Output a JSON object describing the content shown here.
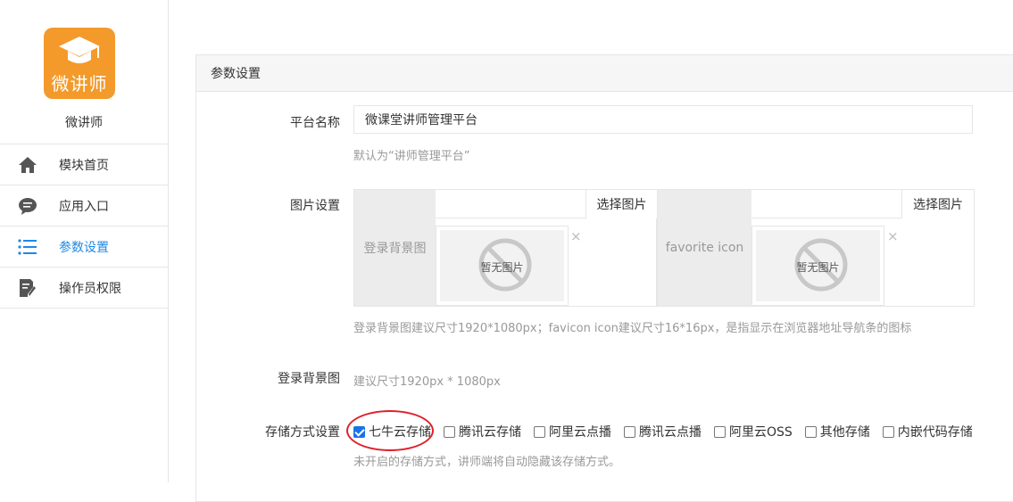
{
  "app": {
    "logo_text": "微讲师",
    "name": "微讲师"
  },
  "nav": [
    {
      "label": "模块首页",
      "icon": "home-icon"
    },
    {
      "label": "应用入口",
      "icon": "chat-bubble-icon"
    },
    {
      "label": "参数设置",
      "icon": "list-icon",
      "active": true
    },
    {
      "label": "操作员权限",
      "icon": "edit-document-icon"
    }
  ],
  "panel": {
    "title": "参数设置"
  },
  "platform_name": {
    "label": "平台名称",
    "value": "微课堂讲师管理平台",
    "help": "默认为“讲师管理平台”"
  },
  "image_settings": {
    "label": "图片设置",
    "blocks": [
      {
        "title": "登录背景图",
        "choose_label": "选择图片",
        "no_image_text": "暂无图片",
        "remove_symbol": "×"
      },
      {
        "title": "favorite icon",
        "choose_label": "选择图片",
        "no_image_text": "暂无图片",
        "remove_symbol": "×"
      }
    ],
    "help": "登录背景图建议尺寸1920*1080px；favicon icon建议尺寸16*16px，是指显示在浏览器地址导航条的图标"
  },
  "login_bg": {
    "label": "登录背景图",
    "help": "建议尺寸1920px * 1080px"
  },
  "storage": {
    "label": "存储方式设置",
    "options": [
      {
        "label": "七牛云存储",
        "checked": true
      },
      {
        "label": "腾讯云存储",
        "checked": false
      },
      {
        "label": "阿里云点播",
        "checked": false
      },
      {
        "label": "腾讯云点播",
        "checked": false
      },
      {
        "label": "阿里云OSS",
        "checked": false
      },
      {
        "label": "其他存储",
        "checked": false
      },
      {
        "label": "内嵌代码存储",
        "checked": false
      }
    ],
    "help": "未开启的存储方式，讲师端将自动隐藏该存储方式。"
  },
  "colors": {
    "brand_orange": "#f39a2b",
    "active_blue": "#1e88e5",
    "annotation_red": "#e0202a"
  }
}
